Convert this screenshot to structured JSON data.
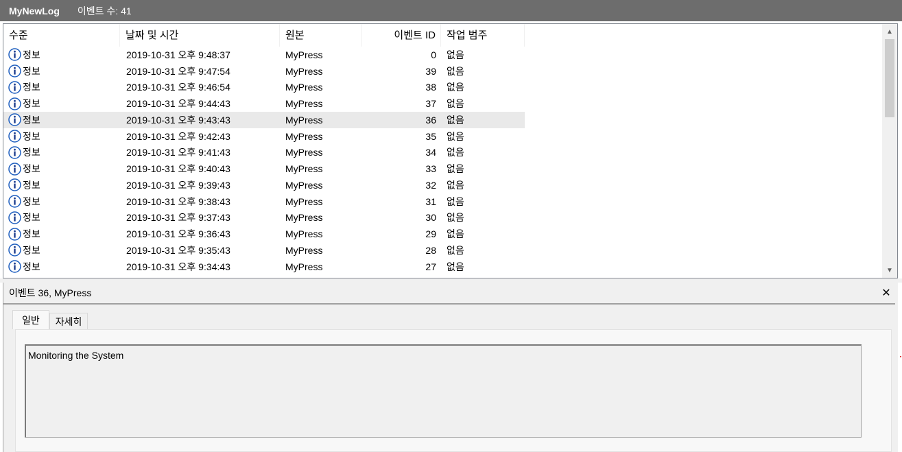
{
  "titlebar": {
    "log_name": "MyNewLog",
    "event_count": "이벤트 수: 41"
  },
  "columns": {
    "level": "수준",
    "date": "날짜 및 시간",
    "source": "원본",
    "event_id": "이벤트 ID",
    "category": "작업 범주"
  },
  "rows": [
    {
      "level": "정보",
      "date": "2019-10-31 오후 9:48:37",
      "source": "MyPress",
      "id": "0",
      "category": "없음"
    },
    {
      "level": "정보",
      "date": "2019-10-31 오후 9:47:54",
      "source": "MyPress",
      "id": "39",
      "category": "없음"
    },
    {
      "level": "정보",
      "date": "2019-10-31 오후 9:46:54",
      "source": "MyPress",
      "id": "38",
      "category": "없음"
    },
    {
      "level": "정보",
      "date": "2019-10-31 오후 9:44:43",
      "source": "MyPress",
      "id": "37",
      "category": "없음"
    },
    {
      "level": "정보",
      "date": "2019-10-31 오후 9:43:43",
      "source": "MyPress",
      "id": "36",
      "category": "없음"
    },
    {
      "level": "정보",
      "date": "2019-10-31 오후 9:42:43",
      "source": "MyPress",
      "id": "35",
      "category": "없음"
    },
    {
      "level": "정보",
      "date": "2019-10-31 오후 9:41:43",
      "source": "MyPress",
      "id": "34",
      "category": "없음"
    },
    {
      "level": "정보",
      "date": "2019-10-31 오후 9:40:43",
      "source": "MyPress",
      "id": "33",
      "category": "없음"
    },
    {
      "level": "정보",
      "date": "2019-10-31 오후 9:39:43",
      "source": "MyPress",
      "id": "32",
      "category": "없음"
    },
    {
      "level": "정보",
      "date": "2019-10-31 오후 9:38:43",
      "source": "MyPress",
      "id": "31",
      "category": "없음"
    },
    {
      "level": "정보",
      "date": "2019-10-31 오후 9:37:43",
      "source": "MyPress",
      "id": "30",
      "category": "없음"
    },
    {
      "level": "정보",
      "date": "2019-10-31 오후 9:36:43",
      "source": "MyPress",
      "id": "29",
      "category": "없음"
    },
    {
      "level": "정보",
      "date": "2019-10-31 오후 9:35:43",
      "source": "MyPress",
      "id": "28",
      "category": "없음"
    },
    {
      "level": "정보",
      "date": "2019-10-31 오후 9:34:43",
      "source": "MyPress",
      "id": "27",
      "category": "없음"
    }
  ],
  "selected_row_id": "36",
  "detail": {
    "title": "이벤트 36, MyPress",
    "tabs": [
      "일반",
      "자세히"
    ],
    "active_tab": "일반",
    "description": "Monitoring the System"
  },
  "icons": {
    "level_icon": "info-icon",
    "close": "close-icon",
    "scroll_up": "chevron-up-icon",
    "scroll_down": "chevron-down-icon"
  },
  "colors": {
    "titlebar": "#6d6d6d",
    "info_icon": "#1f5fbf",
    "selected_row": "#e9e9e9"
  }
}
